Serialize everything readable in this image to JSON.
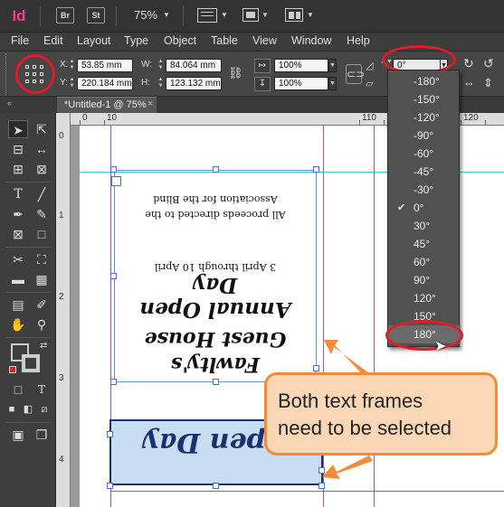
{
  "app": {
    "logo": "Id",
    "buttons": [
      "Br",
      "St"
    ],
    "zoom": "75%"
  },
  "menubar": [
    "File",
    "Edit",
    "Layout",
    "Type",
    "Object",
    "Table",
    "View",
    "Window",
    "Help"
  ],
  "control_panel": {
    "x_value": "53.85 mm",
    "y_value": "220.184 mm",
    "w_label": "W:",
    "w_value": "84.064 mm",
    "h_label": "H:",
    "h_value": "123.132 mm",
    "scale_x": "100%",
    "scale_y": "100%",
    "rotation_value": "0°"
  },
  "document_tab": {
    "title": "*Untitled-1 @ 75%",
    "close": "×"
  },
  "ruler": {
    "h_numbers": [
      "0",
      "10",
      "110",
      "120"
    ],
    "v_numbers": [
      "0",
      "1",
      "2",
      "3",
      "4"
    ]
  },
  "rotation_menu": {
    "options": [
      "-180°",
      "-150°",
      "-120°",
      "-90°",
      "-60°",
      "-45°",
      "-30°",
      "0°",
      "30°",
      "45°",
      "60°",
      "90°",
      "120°",
      "150°",
      "180°"
    ],
    "checked": "0°",
    "hovered": "180°"
  },
  "frame_a_text": {
    "line1": "Association for the Blind",
    "line2": "All proceeds directed to the",
    "line3": "3 April through 10 April",
    "line4": "Annual Open Day",
    "line5": "Guest House",
    "line6": "Fawlty's"
  },
  "frame_b_text": "Open Day",
  "callout": {
    "line1": "Both text frames",
    "line2": "need to be selected"
  },
  "colors": {
    "highlight_ring": "#e01c24",
    "callout_fill": "#fcd7b6",
    "callout_border": "#f28c38",
    "frame_fill": "#c8ddf2",
    "frame_text": "#1a3070",
    "margin_guide": "#a050c8",
    "column_guide": "#3ccad0"
  }
}
